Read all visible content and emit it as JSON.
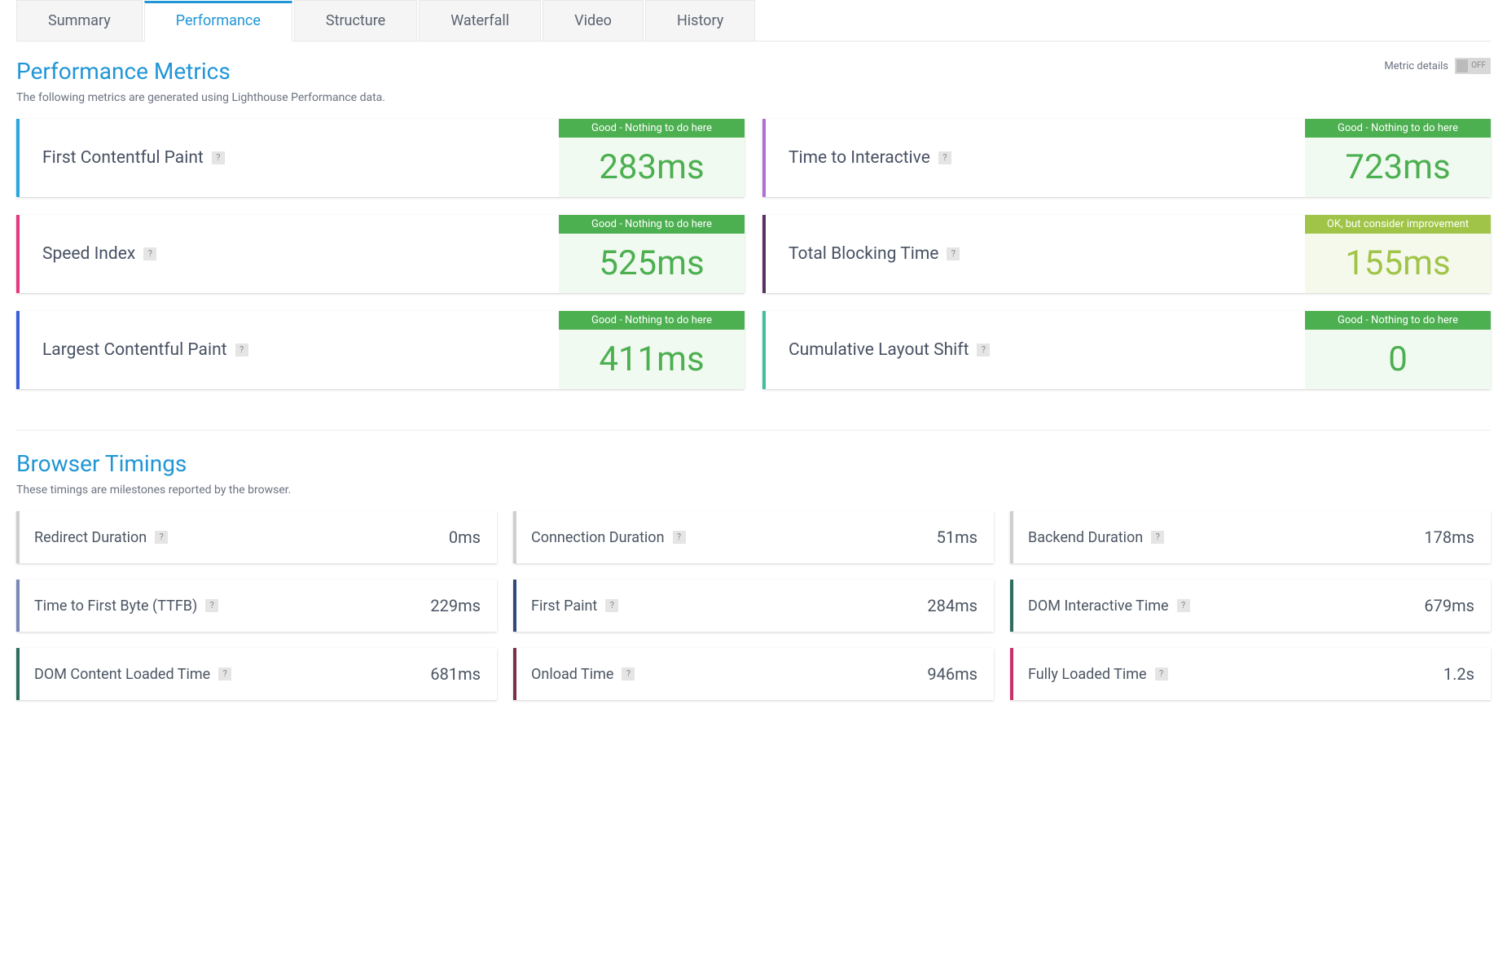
{
  "tabs": [
    "Summary",
    "Performance",
    "Structure",
    "Waterfall",
    "Video",
    "History"
  ],
  "activeTab": 1,
  "perfSection": {
    "title": "Performance Metrics",
    "desc": "The following metrics are generated using Lighthouse Performance data.",
    "toggleLabel": "Metric details",
    "toggleState": "OFF"
  },
  "metrics": [
    {
      "name": "First Contentful Paint",
      "value": "283ms",
      "status": "Good - Nothing to do here",
      "statusClass": "status-good",
      "accent": "#29a7df"
    },
    {
      "name": "Time to Interactive",
      "value": "723ms",
      "status": "Good - Nothing to do here",
      "statusClass": "status-good",
      "accent": "#b06fd6"
    },
    {
      "name": "Speed Index",
      "value": "525ms",
      "status": "Good - Nothing to do here",
      "statusClass": "status-good",
      "accent": "#e6397f"
    },
    {
      "name": "Total Blocking Time",
      "value": "155ms",
      "status": "OK, but consider improvement",
      "statusClass": "status-ok",
      "accent": "#5a2f62"
    },
    {
      "name": "Largest Contentful Paint",
      "value": "411ms",
      "status": "Good - Nothing to do here",
      "statusClass": "status-good",
      "accent": "#3a5fd9"
    },
    {
      "name": "Cumulative Layout Shift",
      "value": "0",
      "status": "Good - Nothing to do here",
      "statusClass": "status-good",
      "accent": "#3fbf9d"
    }
  ],
  "timingsSection": {
    "title": "Browser Timings",
    "desc": "These timings are milestones reported by the browser."
  },
  "timings": [
    {
      "name": "Redirect Duration",
      "value": "0ms",
      "accent": "#cfcfcf"
    },
    {
      "name": "Connection Duration",
      "value": "51ms",
      "accent": "#cfcfcf"
    },
    {
      "name": "Backend Duration",
      "value": "178ms",
      "accent": "#cfcfcf"
    },
    {
      "name": "Time to First Byte (TTFB)",
      "value": "229ms",
      "accent": "#7a88b8"
    },
    {
      "name": "First Paint",
      "value": "284ms",
      "accent": "#2f4a7a"
    },
    {
      "name": "DOM Interactive Time",
      "value": "679ms",
      "accent": "#2f6b5e"
    },
    {
      "name": "DOM Content Loaded Time",
      "value": "681ms",
      "accent": "#2f6b5e"
    },
    {
      "name": "Onload Time",
      "value": "946ms",
      "accent": "#7a2f4a"
    },
    {
      "name": "Fully Loaded Time",
      "value": "1.2s",
      "accent": "#c8326a"
    }
  ]
}
